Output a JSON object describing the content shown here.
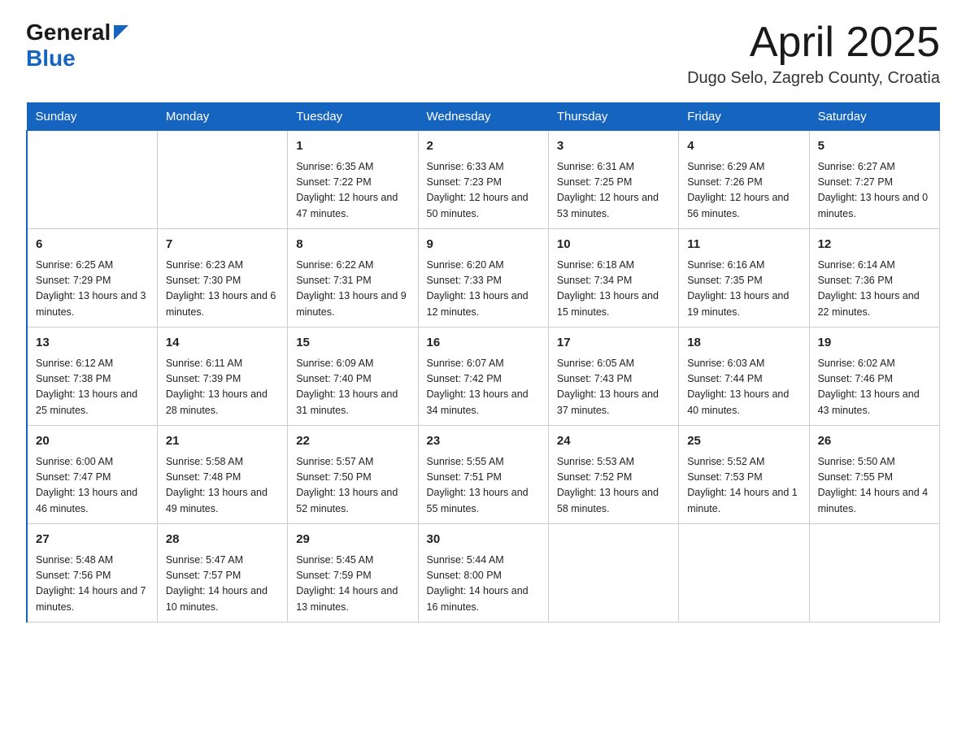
{
  "header": {
    "logo_general": "General",
    "logo_blue": "Blue",
    "month_title": "April 2025",
    "subtitle": "Dugo Selo, Zagreb County, Croatia"
  },
  "calendar": {
    "days_of_week": [
      "Sunday",
      "Monday",
      "Tuesday",
      "Wednesday",
      "Thursday",
      "Friday",
      "Saturday"
    ],
    "weeks": [
      [
        {
          "day": "",
          "sunrise": "",
          "sunset": "",
          "daylight": ""
        },
        {
          "day": "",
          "sunrise": "",
          "sunset": "",
          "daylight": ""
        },
        {
          "day": "1",
          "sunrise": "Sunrise: 6:35 AM",
          "sunset": "Sunset: 7:22 PM",
          "daylight": "Daylight: 12 hours and 47 minutes."
        },
        {
          "day": "2",
          "sunrise": "Sunrise: 6:33 AM",
          "sunset": "Sunset: 7:23 PM",
          "daylight": "Daylight: 12 hours and 50 minutes."
        },
        {
          "day": "3",
          "sunrise": "Sunrise: 6:31 AM",
          "sunset": "Sunset: 7:25 PM",
          "daylight": "Daylight: 12 hours and 53 minutes."
        },
        {
          "day": "4",
          "sunrise": "Sunrise: 6:29 AM",
          "sunset": "Sunset: 7:26 PM",
          "daylight": "Daylight: 12 hours and 56 minutes."
        },
        {
          "day": "5",
          "sunrise": "Sunrise: 6:27 AM",
          "sunset": "Sunset: 7:27 PM",
          "daylight": "Daylight: 13 hours and 0 minutes."
        }
      ],
      [
        {
          "day": "6",
          "sunrise": "Sunrise: 6:25 AM",
          "sunset": "Sunset: 7:29 PM",
          "daylight": "Daylight: 13 hours and 3 minutes."
        },
        {
          "day": "7",
          "sunrise": "Sunrise: 6:23 AM",
          "sunset": "Sunset: 7:30 PM",
          "daylight": "Daylight: 13 hours and 6 minutes."
        },
        {
          "day": "8",
          "sunrise": "Sunrise: 6:22 AM",
          "sunset": "Sunset: 7:31 PM",
          "daylight": "Daylight: 13 hours and 9 minutes."
        },
        {
          "day": "9",
          "sunrise": "Sunrise: 6:20 AM",
          "sunset": "Sunset: 7:33 PM",
          "daylight": "Daylight: 13 hours and 12 minutes."
        },
        {
          "day": "10",
          "sunrise": "Sunrise: 6:18 AM",
          "sunset": "Sunset: 7:34 PM",
          "daylight": "Daylight: 13 hours and 15 minutes."
        },
        {
          "day": "11",
          "sunrise": "Sunrise: 6:16 AM",
          "sunset": "Sunset: 7:35 PM",
          "daylight": "Daylight: 13 hours and 19 minutes."
        },
        {
          "day": "12",
          "sunrise": "Sunrise: 6:14 AM",
          "sunset": "Sunset: 7:36 PM",
          "daylight": "Daylight: 13 hours and 22 minutes."
        }
      ],
      [
        {
          "day": "13",
          "sunrise": "Sunrise: 6:12 AM",
          "sunset": "Sunset: 7:38 PM",
          "daylight": "Daylight: 13 hours and 25 minutes."
        },
        {
          "day": "14",
          "sunrise": "Sunrise: 6:11 AM",
          "sunset": "Sunset: 7:39 PM",
          "daylight": "Daylight: 13 hours and 28 minutes."
        },
        {
          "day": "15",
          "sunrise": "Sunrise: 6:09 AM",
          "sunset": "Sunset: 7:40 PM",
          "daylight": "Daylight: 13 hours and 31 minutes."
        },
        {
          "day": "16",
          "sunrise": "Sunrise: 6:07 AM",
          "sunset": "Sunset: 7:42 PM",
          "daylight": "Daylight: 13 hours and 34 minutes."
        },
        {
          "day": "17",
          "sunrise": "Sunrise: 6:05 AM",
          "sunset": "Sunset: 7:43 PM",
          "daylight": "Daylight: 13 hours and 37 minutes."
        },
        {
          "day": "18",
          "sunrise": "Sunrise: 6:03 AM",
          "sunset": "Sunset: 7:44 PM",
          "daylight": "Daylight: 13 hours and 40 minutes."
        },
        {
          "day": "19",
          "sunrise": "Sunrise: 6:02 AM",
          "sunset": "Sunset: 7:46 PM",
          "daylight": "Daylight: 13 hours and 43 minutes."
        }
      ],
      [
        {
          "day": "20",
          "sunrise": "Sunrise: 6:00 AM",
          "sunset": "Sunset: 7:47 PM",
          "daylight": "Daylight: 13 hours and 46 minutes."
        },
        {
          "day": "21",
          "sunrise": "Sunrise: 5:58 AM",
          "sunset": "Sunset: 7:48 PM",
          "daylight": "Daylight: 13 hours and 49 minutes."
        },
        {
          "day": "22",
          "sunrise": "Sunrise: 5:57 AM",
          "sunset": "Sunset: 7:50 PM",
          "daylight": "Daylight: 13 hours and 52 minutes."
        },
        {
          "day": "23",
          "sunrise": "Sunrise: 5:55 AM",
          "sunset": "Sunset: 7:51 PM",
          "daylight": "Daylight: 13 hours and 55 minutes."
        },
        {
          "day": "24",
          "sunrise": "Sunrise: 5:53 AM",
          "sunset": "Sunset: 7:52 PM",
          "daylight": "Daylight: 13 hours and 58 minutes."
        },
        {
          "day": "25",
          "sunrise": "Sunrise: 5:52 AM",
          "sunset": "Sunset: 7:53 PM",
          "daylight": "Daylight: 14 hours and 1 minute."
        },
        {
          "day": "26",
          "sunrise": "Sunrise: 5:50 AM",
          "sunset": "Sunset: 7:55 PM",
          "daylight": "Daylight: 14 hours and 4 minutes."
        }
      ],
      [
        {
          "day": "27",
          "sunrise": "Sunrise: 5:48 AM",
          "sunset": "Sunset: 7:56 PM",
          "daylight": "Daylight: 14 hours and 7 minutes."
        },
        {
          "day": "28",
          "sunrise": "Sunrise: 5:47 AM",
          "sunset": "Sunset: 7:57 PM",
          "daylight": "Daylight: 14 hours and 10 minutes."
        },
        {
          "day": "29",
          "sunrise": "Sunrise: 5:45 AM",
          "sunset": "Sunset: 7:59 PM",
          "daylight": "Daylight: 14 hours and 13 minutes."
        },
        {
          "day": "30",
          "sunrise": "Sunrise: 5:44 AM",
          "sunset": "Sunset: 8:00 PM",
          "daylight": "Daylight: 14 hours and 16 minutes."
        },
        {
          "day": "",
          "sunrise": "",
          "sunset": "",
          "daylight": ""
        },
        {
          "day": "",
          "sunrise": "",
          "sunset": "",
          "daylight": ""
        },
        {
          "day": "",
          "sunrise": "",
          "sunset": "",
          "daylight": ""
        }
      ]
    ]
  }
}
